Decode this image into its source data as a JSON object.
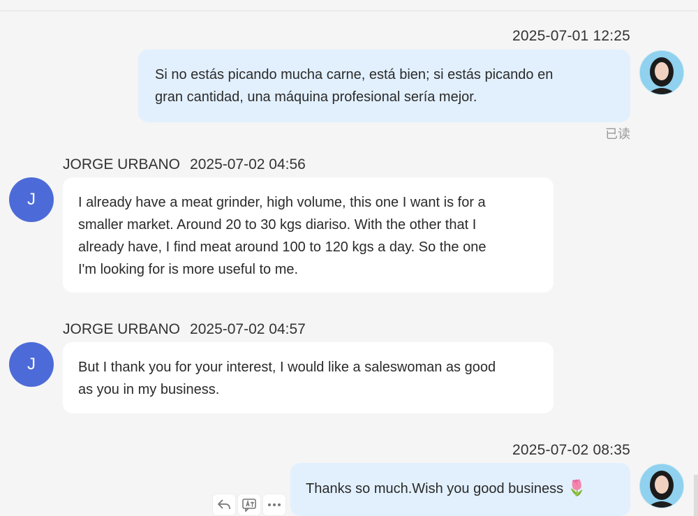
{
  "messages": [
    {
      "timestamp": "2025-07-01 12:25",
      "text_lines": [
        "Si no estás picando mucha carne, está bien; si estás picando en",
        "gran cantidad, una máquina profesional sería mejor."
      ],
      "read_status": "已读"
    },
    {
      "sender": "JORGE URBANO",
      "timestamp": "2025-07-02 04:56",
      "avatar_letter": "J",
      "text_lines": [
        "I already have a meat grinder, high volume, this one I want is for a",
        "smaller market. Around 20 to 30 kgs diariso. With the other that I",
        "already have, I find meat around 100 to 120 kgs a day. So the one",
        "I'm looking for is more useful to me."
      ]
    },
    {
      "sender": "JORGE URBANO",
      "timestamp": "2025-07-02 04:57",
      "avatar_letter": "J",
      "text_lines": [
        "But I thank you for your interest, I would like a saleswoman as good",
        "as you in my business."
      ]
    },
    {
      "timestamp": "2025-07-02 08:35",
      "text": "Thanks so much.Wish you good business",
      "emoji": "🌷"
    }
  ],
  "colors": {
    "outgoing_bubble": "#e2f0fe",
    "incoming_bubble": "#ffffff",
    "avatar_letter_bg": "#4d6bd8"
  },
  "icons": [
    "reply-icon",
    "translate-icon",
    "more-icon"
  ]
}
